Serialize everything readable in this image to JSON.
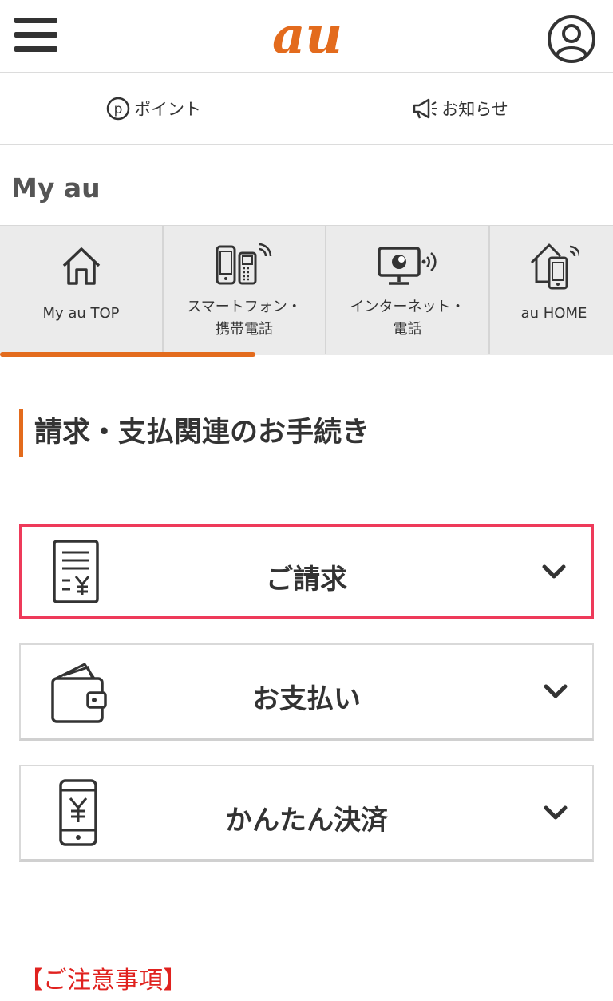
{
  "header": {
    "logo_text": "au",
    "brand_color": "#E36B1D",
    "menu_icon": "hamburger-menu-icon",
    "account_icon": "user-icon"
  },
  "subnav": {
    "points_label": "ポイント",
    "news_label": "お知らせ"
  },
  "myau": {
    "title": "My au"
  },
  "tabs": [
    {
      "label": "My au TOP",
      "icon": "home-icon",
      "active": true
    },
    {
      "label": "スマートフォン・\n携帯電話",
      "icon": "smartphone-icon"
    },
    {
      "label": "インターネット・\n電話",
      "icon": "internet-icon"
    },
    {
      "label": "au HOME",
      "icon": "smart-home-icon"
    }
  ],
  "section": {
    "heading": "請求・支払関連のお手続き"
  },
  "accordions": [
    {
      "label": "ご請求",
      "icon": "invoice-yen-icon",
      "selected": true
    },
    {
      "label": "お支払い",
      "icon": "wallet-icon"
    },
    {
      "label": "かんたん決済",
      "icon": "phone-yen-icon"
    }
  ],
  "notice": {
    "label": "【ご注意事項】"
  },
  "colors": {
    "accent": "#E36B1D",
    "highlight": "#EE3A5A",
    "notice": "#E0221F"
  }
}
